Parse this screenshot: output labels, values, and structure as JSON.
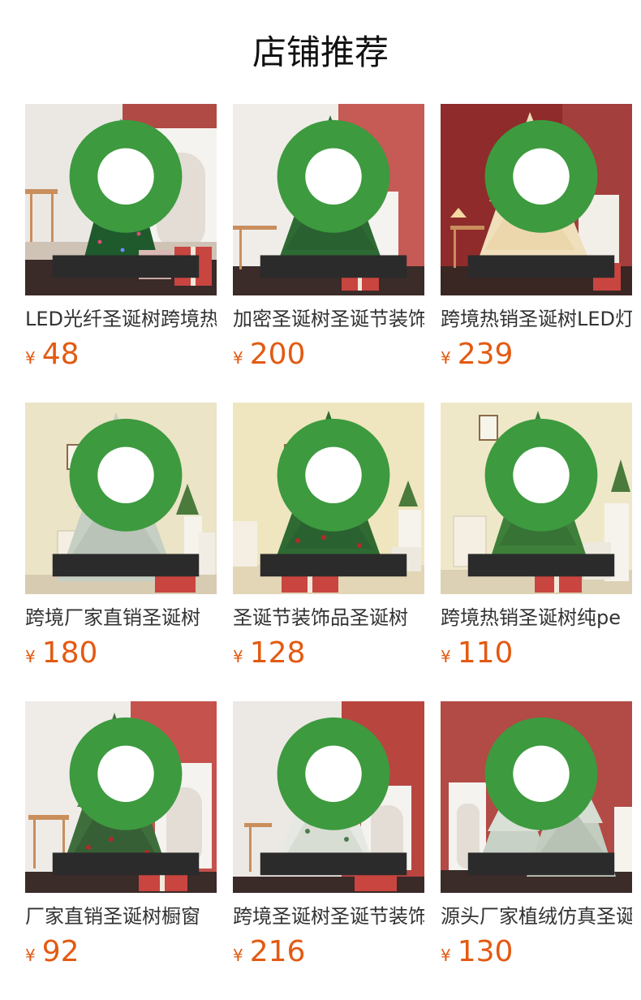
{
  "page": {
    "title": "店铺推荐"
  },
  "colors": {
    "price": "#e35a12",
    "title_text": "#111111",
    "body_text": "#333333",
    "wall_red": "#b04a45",
    "wall_cream": "#ece4c4",
    "tree_green": "#2f6b33",
    "tree_flocked": "#c9d3c6",
    "tree_warm_white": "#f3e4c1"
  },
  "products": [
    {
      "name": "LED光纤圣诞树跨境热销",
      "currency": "¥",
      "price": "48",
      "scene": "red-wall",
      "tree": "fiber-led-icon"
    },
    {
      "name": "加密圣诞树圣诞节装饰",
      "currency": "¥",
      "price": "200",
      "scene": "red-wall",
      "tree": "green-tree-icon"
    },
    {
      "name": "跨境热销圣诞树LED灯",
      "currency": "¥",
      "price": "239",
      "scene": "red-wall-dark",
      "tree": "warm-white-tree-icon"
    },
    {
      "name": "跨境厂家直销圣诞树",
      "currency": "¥",
      "price": "180",
      "scene": "cream-wall",
      "tree": "flocked-tree-icon"
    },
    {
      "name": "圣诞节装饰品圣诞树",
      "currency": "¥",
      "price": "128",
      "scene": "cream-wall",
      "tree": "berry-tree-icon"
    },
    {
      "name": "跨境热销圣诞树纯pe",
      "currency": "¥",
      "price": "110",
      "scene": "cream-wall",
      "tree": "green-tree-icon"
    },
    {
      "name": "厂家直销圣诞树橱窗",
      "currency": "¥",
      "price": "92",
      "scene": "red-wall",
      "tree": "berry-tree-icon"
    },
    {
      "name": "跨境圣诞树圣诞节装饰",
      "currency": "¥",
      "price": "216",
      "scene": "red-wall",
      "tree": "snowy-berry-tree-icon"
    },
    {
      "name": "源头厂家植绒仿真圣诞",
      "currency": "¥",
      "price": "130",
      "scene": "red-wall",
      "tree": "flocked-pair-tree-icon"
    }
  ]
}
